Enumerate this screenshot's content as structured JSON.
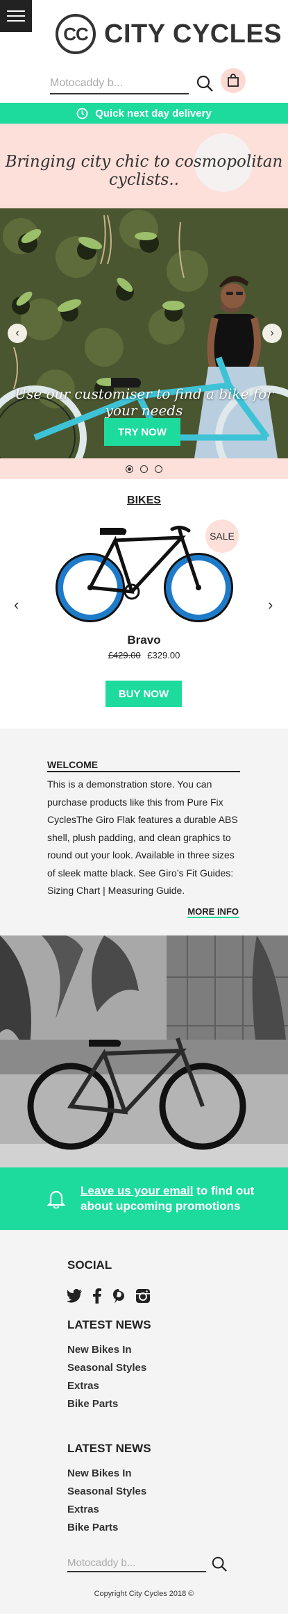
{
  "brand": {
    "logo_mark": "CC",
    "name": "CITY CYCLES"
  },
  "search": {
    "placeholder": "Motocaddy b..."
  },
  "delivery": {
    "text": "Quick next day delivery"
  },
  "banner": {
    "tagline": "Bringing city chic to cosmopolitan cyclists.."
  },
  "hero": {
    "caption": "Use our customiser to find a bike for your needs",
    "button": "TRY NOW",
    "prev": "‹",
    "next": "›",
    "slide_count": 3,
    "active_slide": 1
  },
  "products": {
    "heading": "BIKES",
    "badge": "SALE",
    "name": "Bravo",
    "old_price": "£429.00",
    "price": "£329.00",
    "button": "BUY NOW",
    "prev": "‹",
    "next": "›"
  },
  "welcome": {
    "title": "WELCOME",
    "body": "This is a demonstration store. You can purchase products like this from Pure Fix CyclesThe Giro Flak features a durable ABS shell, plush padding, and clean graphics to round out your look. Available in three sizes of sleek matte black. See Giro’s Fit Guides: Sizing Chart | Measuring Guide.",
    "more": "MORE INFO"
  },
  "promo": {
    "link": "Leave us your email",
    "rest_line1": " to find out",
    "line2": "about upcoming promotions"
  },
  "footer": {
    "social_heading": "SOCIAL",
    "social_icons": [
      "twitter-icon",
      "facebook-icon",
      "pinterest-icon",
      "instagram-icon"
    ],
    "news1_heading": "LATEST NEWS",
    "news1": [
      "New Bikes In",
      "Seasonal Styles",
      "Extras",
      "Bike Parts"
    ],
    "news2_heading": "LATEST NEWS",
    "news2": [
      "New Bikes In",
      "Seasonal Styles",
      "Extras",
      "Bike Parts"
    ],
    "search_placeholder": "Motocaddy b...",
    "copyright": "Copyright City Cycles 2018 ©"
  },
  "colors": {
    "accent": "#1ddb9c",
    "pink": "#fde0da",
    "dark": "#222222"
  }
}
